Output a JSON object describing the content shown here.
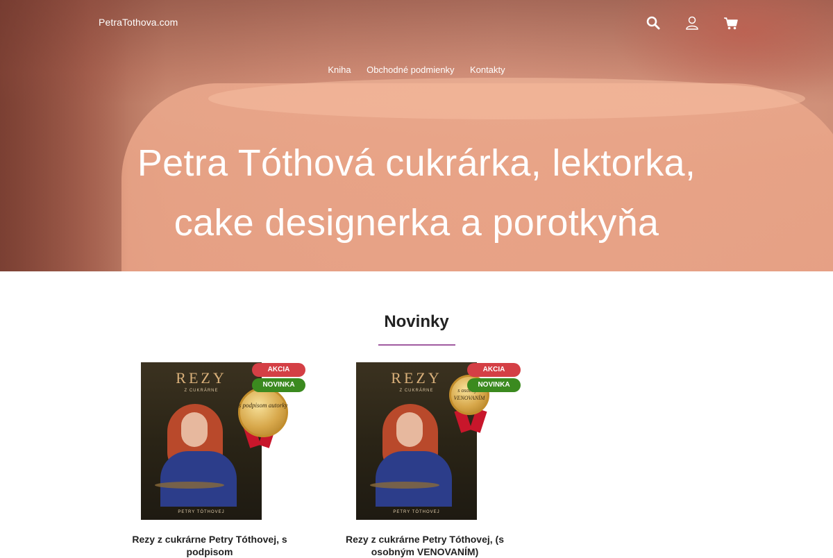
{
  "header": {
    "brand": "PetraTothova.com",
    "icons": [
      "search-icon",
      "user-icon",
      "cart-icon"
    ]
  },
  "nav": {
    "items": [
      {
        "label": "Kniha"
      },
      {
        "label": "Obchodné podmienky"
      },
      {
        "label": "Kontakty"
      }
    ]
  },
  "hero": {
    "title_line1": "Petra Tóthová cukrárka, lektorka,",
    "title_line2": "cake designerka a porotkyňa"
  },
  "section": {
    "title": "Novinky",
    "accent_color": "#a05aa0"
  },
  "products": [
    {
      "cover_title": "REZY",
      "cover_subtitle": "Z CUKRÁRNE",
      "cover_author": "PETRY TÓTHOVEJ",
      "seal_text": "s podpisom autorky",
      "badge_sale": "AKCIA",
      "badge_new": "NOVINKA",
      "name_line1": "Rezy z cukrárne Petry Tóthovej, s",
      "name_line2": "podpisom"
    },
    {
      "cover_title": "REZY",
      "cover_subtitle": "Z CUKRÁRNE",
      "cover_author": "PETRY TÓTHOVEJ",
      "seal_text": "s osobným VENOVANÍM",
      "badge_sale": "AKCIA",
      "badge_new": "NOVINKA",
      "name_line1": "Rezy z cukrárne Petry Tóthovej, (s",
      "name_line2": "osobným VENOVANÍM)"
    }
  ],
  "colors": {
    "badge_sale": "#d43f45",
    "badge_new": "#3b8a1f",
    "hero_tone": "#dfa088"
  }
}
